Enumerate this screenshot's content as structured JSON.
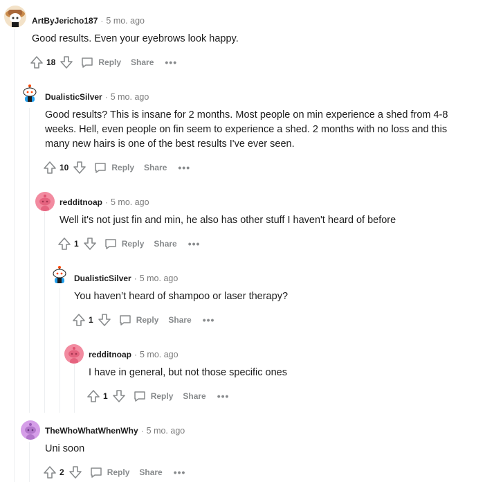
{
  "actions": {
    "reply_label": "Reply",
    "share_label": "Share",
    "more_label": "•••"
  },
  "comments": [
    {
      "username": "ArtByJericho187",
      "time": "5 mo. ago",
      "body": "Good results. Even your eyebrows look happy.",
      "score": "18"
    },
    {
      "username": "DualisticSilver",
      "time": "5 mo. ago",
      "body": "Good results? This is insane for 2 months. Most people on min experience a shed from 4-8 weeks. Hell, even people on fin seem to experience a shed. 2 months with no loss and this many new hairs is one of the best results I've ever seen.",
      "score": "10"
    },
    {
      "username": "redditnoap",
      "time": "5 mo. ago",
      "body": "Well it's not just fin and min, he also has other stuff I haven't heard of before",
      "score": "1"
    },
    {
      "username": "DualisticSilver",
      "time": "5 mo. ago",
      "body": "You haven’t heard of shampoo or laser therapy?",
      "score": "1"
    },
    {
      "username": "redditnoap",
      "time": "5 mo. ago",
      "body": "I have in general, but not those specific ones",
      "score": "1"
    },
    {
      "username": "TheWhoWhatWhenWhy",
      "time": "5 mo. ago",
      "body": "Uni soon",
      "score": "2"
    }
  ],
  "colors": {
    "thread_line": "#edeff1",
    "meta_gray": "#7c7c7c",
    "action_gray": "#878a8c",
    "text": "#1c1c1c"
  }
}
